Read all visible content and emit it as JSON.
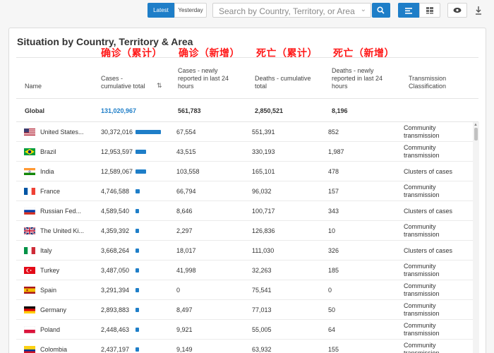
{
  "toolbar": {
    "latest_label": "Latest",
    "yesterday_label": "Yesterday",
    "search_placeholder": "Search by Country, Territory, or Area",
    "accent": "#1e7ec8"
  },
  "panel": {
    "title": "Situation by Country, Territory & Area",
    "overlay_labels": [
      "确诊（累计）",
      "确诊（新增）",
      "死亡（累计）",
      "死亡（新增）"
    ]
  },
  "table": {
    "headers": {
      "name": "Name",
      "cases": "Cases - cumulative total",
      "new_cases": "Cases - newly reported in last 24 hours",
      "deaths": "Deaths - cumulative total",
      "new_deaths": "Deaths - newly reported in last 24 hours",
      "transmission": "Transmission Classification"
    },
    "global": {
      "name": "Global",
      "cases": "131,020,967",
      "new_cases": "561,783",
      "deaths": "2,850,521",
      "new_deaths": "8,196"
    },
    "rows": [
      {
        "name": "United States...",
        "flag": "us-flag-icon",
        "cases": "30,372,016",
        "bar": 1.0,
        "new_cases": "67,554",
        "deaths": "551,391",
        "new_deaths": "852",
        "transmission": "Community transmission"
      },
      {
        "name": "Brazil",
        "flag": "brazil-flag-icon",
        "cases": "12,953,597",
        "bar": 0.43,
        "new_cases": "43,515",
        "deaths": "330,193",
        "new_deaths": "1,987",
        "transmission": "Community transmission"
      },
      {
        "name": "India",
        "flag": "india-flag-icon",
        "cases": "12,589,067",
        "bar": 0.41,
        "new_cases": "103,558",
        "deaths": "165,101",
        "new_deaths": "478",
        "transmission": "Clusters of cases"
      },
      {
        "name": "France",
        "flag": "france-flag-icon",
        "cases": "4,746,588",
        "bar": 0.16,
        "new_cases": "66,794",
        "deaths": "96,032",
        "new_deaths": "157",
        "transmission": "Community transmission"
      },
      {
        "name": "Russian Fed...",
        "flag": "russia-flag-icon",
        "cases": "4,589,540",
        "bar": 0.15,
        "new_cases": "8,646",
        "deaths": "100,717",
        "new_deaths": "343",
        "transmission": "Clusters of cases"
      },
      {
        "name": "The United Ki...",
        "flag": "uk-flag-icon",
        "cases": "4,359,392",
        "bar": 0.14,
        "new_cases": "2,297",
        "deaths": "126,836",
        "new_deaths": "10",
        "transmission": "Community transmission"
      },
      {
        "name": "Italy",
        "flag": "italy-flag-icon",
        "cases": "3,668,264",
        "bar": 0.12,
        "new_cases": "18,017",
        "deaths": "111,030",
        "new_deaths": "326",
        "transmission": "Clusters of cases"
      },
      {
        "name": "Turkey",
        "flag": "turkey-flag-icon",
        "cases": "3,487,050",
        "bar": 0.115,
        "new_cases": "41,998",
        "deaths": "32,263",
        "new_deaths": "185",
        "transmission": "Community transmission"
      },
      {
        "name": "Spain",
        "flag": "spain-flag-icon",
        "cases": "3,291,394",
        "bar": 0.11,
        "new_cases": "0",
        "deaths": "75,541",
        "new_deaths": "0",
        "transmission": "Community transmission"
      },
      {
        "name": "Germany",
        "flag": "germany-flag-icon",
        "cases": "2,893,883",
        "bar": 0.095,
        "new_cases": "8,497",
        "deaths": "77,013",
        "new_deaths": "50",
        "transmission": "Community transmission"
      },
      {
        "name": "Poland",
        "flag": "poland-flag-icon",
        "cases": "2,448,463",
        "bar": 0.08,
        "new_cases": "9,921",
        "deaths": "55,005",
        "new_deaths": "64",
        "transmission": "Community transmission"
      },
      {
        "name": "Colombia",
        "flag": "colombia-flag-icon",
        "cases": "2,437,197",
        "bar": 0.08,
        "new_cases": "9,149",
        "deaths": "63,932",
        "new_deaths": "155",
        "transmission": "Community transmission"
      }
    ]
  }
}
